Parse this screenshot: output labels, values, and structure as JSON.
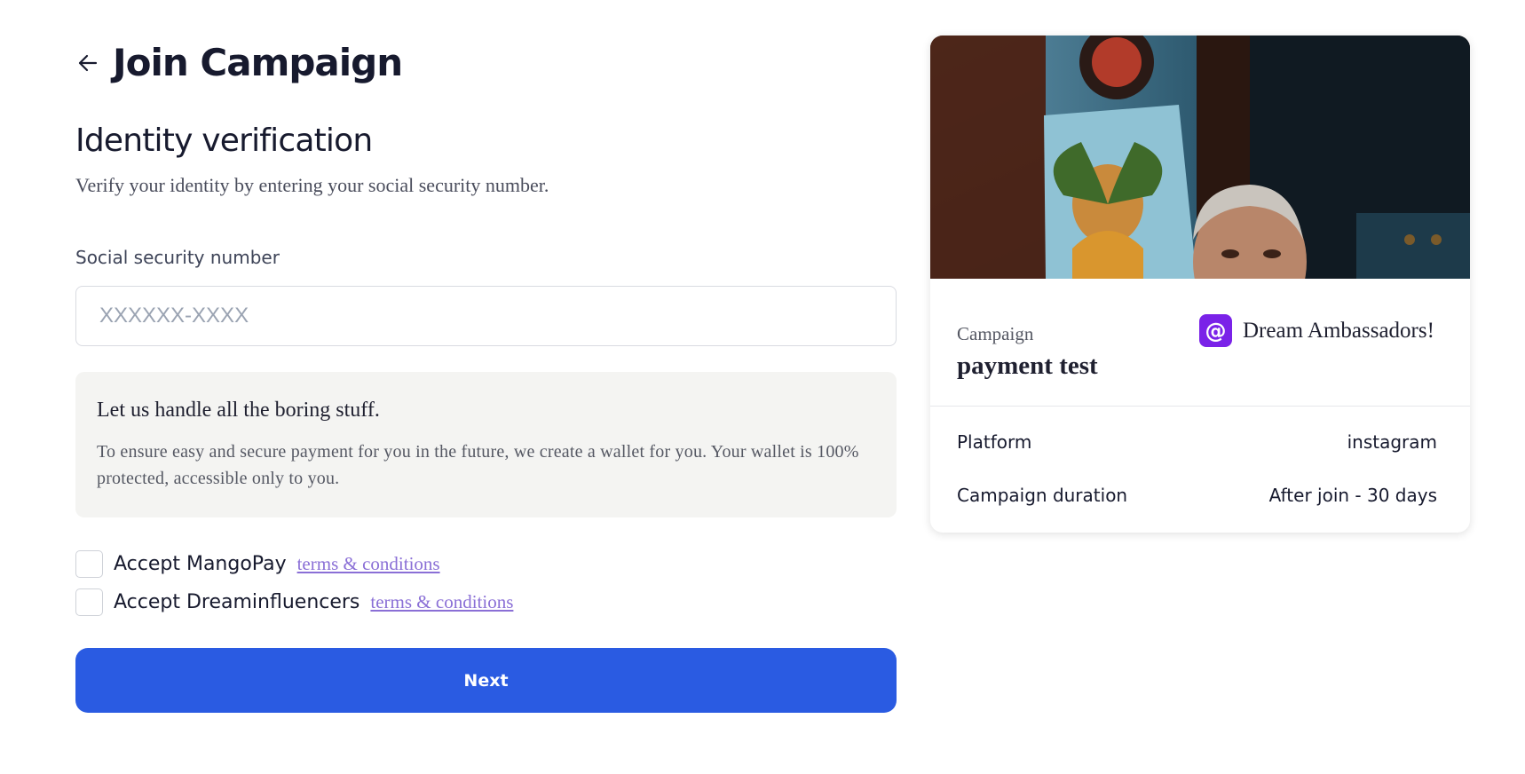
{
  "header": {
    "title": "Join Campaign",
    "back_icon": "arrow-left-icon"
  },
  "verification": {
    "title": "Identity verification",
    "description": "Verify your identity by entering your social security number."
  },
  "ssn_field": {
    "label": "Social security number",
    "placeholder": "XXXXXX-XXXX",
    "value": ""
  },
  "info_box": {
    "title": "Let us handle all the boring stuff.",
    "text": "To ensure easy and secure payment for you in the future, we create a wallet for you. Your wallet is 100% protected, accessible only to you."
  },
  "agreements": [
    {
      "label": "Accept MangoPay",
      "link": "terms & conditions",
      "checked": false
    },
    {
      "label": "Accept Dreaminfluencers",
      "link": "terms & conditions",
      "checked": false
    }
  ],
  "next_button": {
    "label": "Next",
    "color": "#2a5be2"
  },
  "campaign_card": {
    "campaign_label": "Campaign",
    "campaign_name": "payment test",
    "brand_name": "Dream Ambassadors!",
    "brand_logo_icon": "at-sign-icon",
    "brand_color": "#7a22e8",
    "details": [
      {
        "label": "Platform",
        "value": "instagram"
      },
      {
        "label": "Campaign duration",
        "value": "After join - 30 days"
      }
    ]
  },
  "colors": {
    "link": "#8a6fd6",
    "info_bg": "#f4f4f2",
    "text_dark": "#171a2e"
  }
}
